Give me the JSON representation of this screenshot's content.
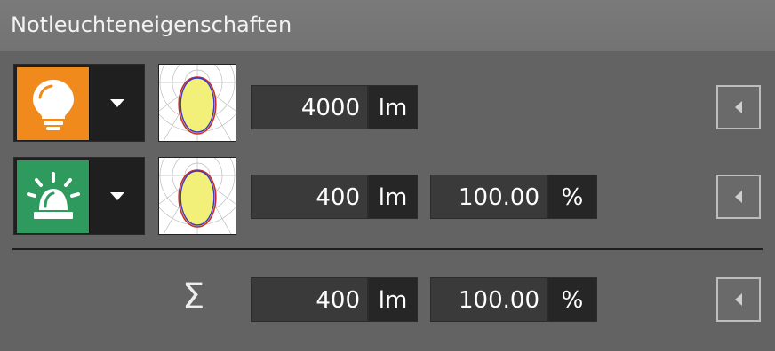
{
  "panel": {
    "title": "Notleuchteneigenschaften"
  },
  "rows": [
    {
      "icon": "light-bulb-icon",
      "icon_bg": "#f08a1c",
      "flux_value": "4000",
      "flux_unit": "lm"
    },
    {
      "icon": "emergency-beacon-icon",
      "icon_bg": "#2f9a5e",
      "flux_value": "400",
      "flux_unit": "lm",
      "percent_value": "100.00",
      "percent_unit": "%"
    }
  ],
  "sum": {
    "symbol": "Σ",
    "flux_value": "400",
    "flux_unit": "lm",
    "percent_value": "100.00",
    "percent_unit": "%"
  }
}
